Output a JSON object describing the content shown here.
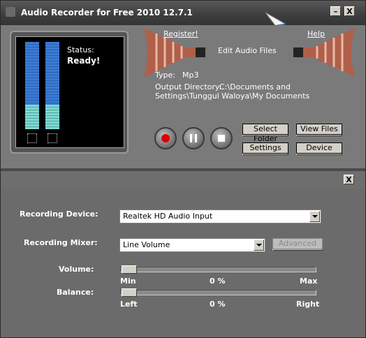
{
  "window": {
    "title": "Audio Recorder for Free 2010 12.7.1"
  },
  "titlebar": {
    "minimize_label": "–",
    "close_label": "X"
  },
  "top": {
    "register_label": "Register!",
    "help_label": "Help",
    "edit_label": "Edit Audio Files",
    "type_label": "Type:",
    "type_value": "Mp3",
    "output_label": "Output Directory:",
    "output_value_line1": "C:\\Documents and",
    "output_value_line2": "Settings\\Tunggul Waloya\\My Documents",
    "status_label": "Status:",
    "status_value": "Ready!",
    "meter_levels": [
      0.4,
      0.4
    ]
  },
  "buttons": {
    "select_folder": "Select Folder",
    "view_files": "View Files",
    "settings": "Settings",
    "device": "Device"
  },
  "lower": {
    "close_label": "X",
    "recording_device_label": "Recording Device:",
    "recording_device_value": "Realtek HD Audio Input",
    "recording_mixer_label": "Recording Mixer:",
    "recording_mixer_value": "Line Volume",
    "advanced_label": "Advanced",
    "volume_label": "Volume:",
    "volume_min": "Min",
    "volume_value": "0 %",
    "volume_max": "Max",
    "balance_label": "Balance:",
    "balance_left": "Left",
    "balance_value": "0 %",
    "balance_right": "Right"
  },
  "colors": {
    "record": "#e00000",
    "meter_blue": "#3a7bd5",
    "meter_cyan": "#7fd8d0",
    "cursor": "#2a7fd8"
  }
}
